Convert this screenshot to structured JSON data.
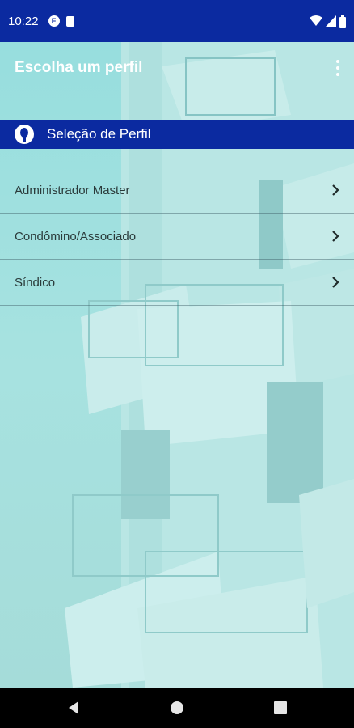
{
  "status_bar": {
    "time": "10:22",
    "notification_icons": [
      "f-circle-icon",
      "sim-card-icon"
    ],
    "system_icons": [
      "wifi-icon",
      "signal-icon",
      "battery-icon"
    ]
  },
  "app_bar": {
    "title": "Escolha um perfil",
    "menu_icon": "more-vert-icon"
  },
  "section": {
    "icon": "person-icon",
    "title": "Seleção de Perfil"
  },
  "profiles": {
    "items": [
      {
        "label": "Administrador Master"
      },
      {
        "label": "Condômino/Associado"
      },
      {
        "label": "Síndico"
      }
    ]
  },
  "nav_bar": {
    "buttons": [
      "back-icon",
      "home-icon",
      "recents-icon"
    ]
  },
  "colors": {
    "primary": "#0b2aa0",
    "background": "#9fdcdc",
    "text": "#2a3a3a",
    "nav_bar": "#000000"
  }
}
